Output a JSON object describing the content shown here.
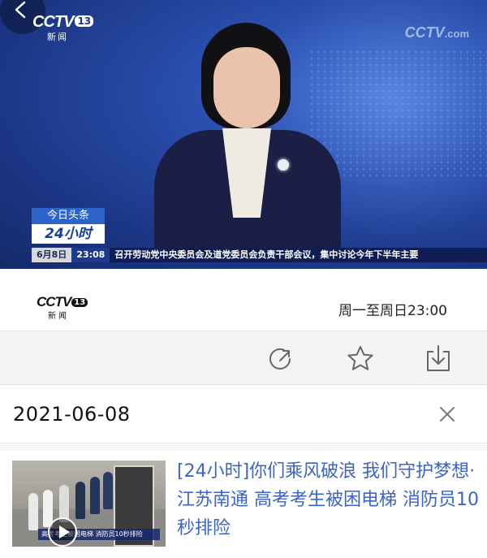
{
  "player": {
    "channel_logo": "CCTV",
    "channel_number": "13",
    "channel_sub": "新闻",
    "watermark": "CCTV",
    "watermark_suffix": ".com",
    "tag_top": "今日头条",
    "tag_bottom": "24小时",
    "ticker_date": "6月8日",
    "ticker_time": "23:08",
    "ticker_text": "召开劳动党中央委员会及道党委员会负责干部会议，集中讨论今年下半年主要"
  },
  "program": {
    "logo_word": "CCTV",
    "logo_number": "13",
    "logo_sub": "新闻",
    "schedule": "周一至周日23:00"
  },
  "actions": [
    {
      "icon": "share-icon"
    },
    {
      "icon": "star-icon"
    },
    {
      "icon": "download-icon"
    }
  ],
  "date_filter": {
    "value": "2021-06-08",
    "close_icon": "close-icon"
  },
  "list": [
    {
      "title": "[24小时]你们乘风破浪 我们守护梦想·江苏南通 高考考生被困电梯 消防员10秒排险",
      "thumb_caption": "高考考生被困电梯 消防员10秒排险"
    }
  ],
  "colors": {
    "player_bg": "#1c3787",
    "title_link": "#3b64c5",
    "action_bar_bg": "#f3f3f3"
  }
}
